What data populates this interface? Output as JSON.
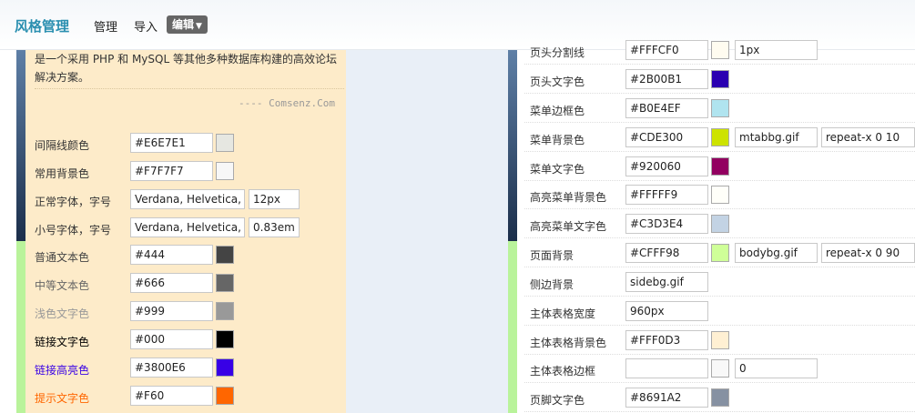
{
  "nav": {
    "brand": "风格管理",
    "manage": "管理",
    "import": "导入",
    "edit": "编辑",
    "edit_caret": "▼"
  },
  "intro": {
    "text": "是一个采用 PHP 和 MySQL 等其他多种数据库构建的高效论坛解决方案。",
    "credit": "---- Comsenz.Com"
  },
  "left_rows": [
    {
      "label": "间隔线颜色",
      "value": "#E6E7E1",
      "swatch": "#E6E7E1",
      "label_color": "#333333"
    },
    {
      "label": "常用背景色",
      "value": "#F7F7F7",
      "swatch": "#F7F7F7",
      "label_color": "#333333"
    },
    {
      "label": "正常字体，字号",
      "value": "Verdana, Helvetica,",
      "extra": "12px",
      "label_color": "#333333"
    },
    {
      "label": "小号字体，字号",
      "value": "Verdana, Helvetica,",
      "extra": "0.83em",
      "label_color": "#333333"
    },
    {
      "label": "普通文本色",
      "value": "#444",
      "swatch": "#444444",
      "label_color": "#444444"
    },
    {
      "label": "中等文本色",
      "value": "#666",
      "swatch": "#666666",
      "label_color": "#666666"
    },
    {
      "label": "浅色文字色",
      "value": "#999",
      "swatch": "#999999",
      "label_color": "#999999"
    },
    {
      "label": "链接文字色",
      "value": "#000",
      "swatch": "#000000",
      "label_color": "#000000"
    },
    {
      "label": "链接高亮色",
      "value": "#3800E6",
      "swatch": "#3800E6",
      "label_color": "#3800E6"
    },
    {
      "label": "提示文字色",
      "value": "#F60",
      "swatch": "#FF6600",
      "label_color": "#FF6600"
    }
  ],
  "right_rows": [
    {
      "label": "页头分割线",
      "value": "#FFFCF0",
      "swatch": "#FFFCF0",
      "extra": "1px"
    },
    {
      "label": "页头文字色",
      "value": "#2B00B1",
      "swatch": "#2B00B1"
    },
    {
      "label": "菜单边框色",
      "value": "#B0E4EF",
      "swatch": "#B0E4EF"
    },
    {
      "label": "菜单背景色",
      "value": "#CDE300",
      "swatch": "#CDE300",
      "img": "mtabbg.gif",
      "repeat": "repeat-x 0 10"
    },
    {
      "label": "菜单文字色",
      "value": "#920060",
      "swatch": "#920060"
    },
    {
      "label": "高亮菜单背景色",
      "value": "#FFFFF9",
      "swatch": "#FFFFF9"
    },
    {
      "label": "高亮菜单文字色",
      "value": "#C3D3E4",
      "swatch": "#C3D3E4"
    },
    {
      "label": "页面背景",
      "value": "#CFFF98",
      "swatch": "#CFFF98",
      "img": "bodybg.gif",
      "repeat": "repeat-x 0 90"
    },
    {
      "label": "侧边背景",
      "value": "sidebg.gif"
    },
    {
      "label": "主体表格宽度",
      "value": "960px"
    },
    {
      "label": "主体表格背景色",
      "value": "#FFF0D3",
      "swatch": "#FFF0D3"
    },
    {
      "label": "主体表格边框",
      "value": "",
      "swatch": "#F8F8F8",
      "extra": "0"
    },
    {
      "label": "页脚文字色",
      "value": "#8691A2",
      "swatch": "#8691A2"
    }
  ]
}
